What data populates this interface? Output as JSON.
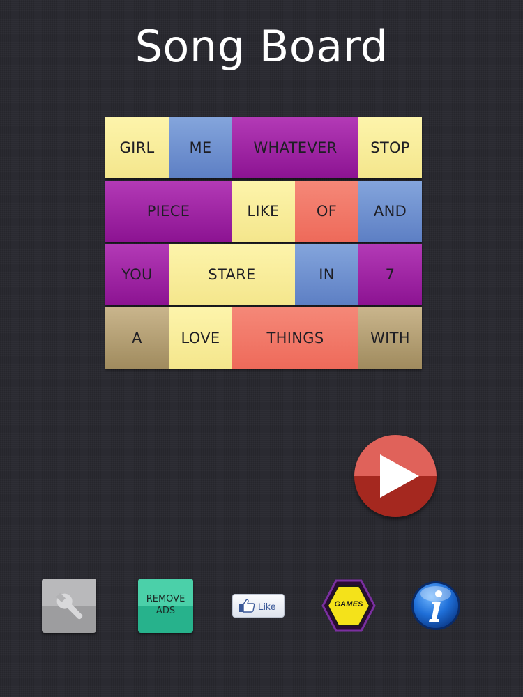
{
  "app": {
    "title": "Song Board"
  },
  "board": {
    "rows": [
      [
        {
          "word": "GIRL",
          "color": "yellow"
        },
        {
          "word": "ME",
          "color": "blue"
        },
        {
          "word": "WHATEVER",
          "color": "purple"
        },
        {
          "word": "STOP",
          "color": "yellow"
        }
      ],
      [
        {
          "word": "PIECE",
          "color": "purple"
        },
        {
          "word": "LIKE",
          "color": "yellow"
        },
        {
          "word": "OF",
          "color": "red"
        },
        {
          "word": "AND",
          "color": "blue"
        }
      ],
      [
        {
          "word": "YOU",
          "color": "purple"
        },
        {
          "word": "STARE",
          "color": "yellow"
        },
        {
          "word": "IN",
          "color": "blue"
        },
        {
          "word": "7",
          "color": "purple"
        }
      ],
      [
        {
          "word": "A",
          "color": "gold"
        },
        {
          "word": "LOVE",
          "color": "yellow"
        },
        {
          "word": "THINGS",
          "color": "red"
        },
        {
          "word": "WITH",
          "color": "gold"
        }
      ]
    ]
  },
  "colors": {
    "yellow": "#f7eb97",
    "blue": "#6d8fcf",
    "purple": "#9e22a3",
    "red": "#f07a6a",
    "gold": "#b5a075",
    "play_button": "#c8443c",
    "background": "#2a2a31"
  },
  "toolbar": {
    "settings_icon": "wrench-icon",
    "remove_ads_line1": "REMOVE",
    "remove_ads_line2": "ADS",
    "like_label": "Like",
    "like_icon": "thumbs-up-icon",
    "games_label": "GAMES",
    "info_icon": "info-icon"
  },
  "play": {
    "icon": "play-icon"
  }
}
